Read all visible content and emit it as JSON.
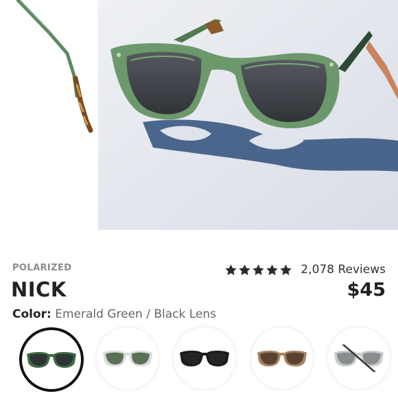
{
  "product": {
    "badge": "POLARIZED",
    "name": "NICK",
    "price": "$45",
    "color_label": "Color:",
    "color_value": " Emerald Green / Black Lens"
  },
  "rating": {
    "stars": 5,
    "reviews_text": "2,078 Reviews"
  },
  "variants": [
    {
      "name": "Emerald Green / Black Lens",
      "frame": "#3e6a44",
      "lens": "#2e3336",
      "selected": true,
      "available": true
    },
    {
      "name": "Clear / Green Lens",
      "frame": "#d8dbd8",
      "lens": "#5b7156",
      "selected": false,
      "available": true
    },
    {
      "name": "Black / Black Lens",
      "frame": "#1b1b1b",
      "lens": "#252525",
      "selected": false,
      "available": true
    },
    {
      "name": "Tan / Brown Lens",
      "frame": "#a58360",
      "lens": "#5a4231",
      "selected": false,
      "available": true
    },
    {
      "name": "Clear / Grey Lens",
      "frame": "#c9cbcc",
      "lens": "#8a8d90",
      "selected": false,
      "available": false
    }
  ],
  "colors": {
    "star": "#2b2b2b",
    "badge": "#8c8c8c"
  }
}
